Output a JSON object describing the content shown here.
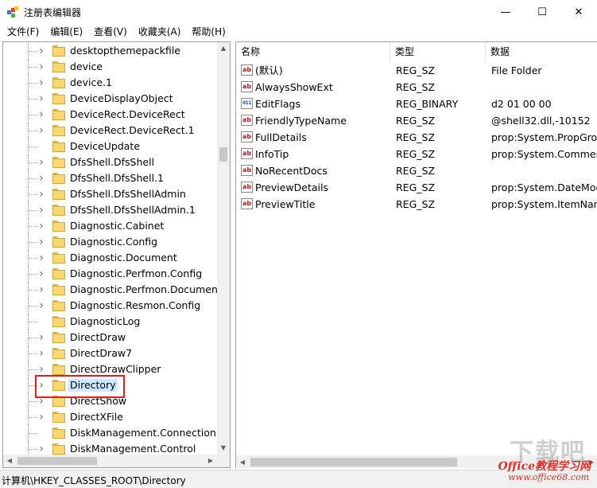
{
  "window": {
    "title": "注册表编辑器",
    "min_glyph": "—",
    "max_glyph": "☐",
    "close_glyph": "✕"
  },
  "menu": [
    "文件(F)",
    "编辑(E)",
    "查看(V)",
    "收藏夹(A)",
    "帮助(H)"
  ],
  "tree": {
    "items": [
      {
        "label": "desktopthemepackfile",
        "expandable": true
      },
      {
        "label": "device",
        "expandable": true
      },
      {
        "label": "device.1",
        "expandable": true
      },
      {
        "label": "DeviceDisplayObject",
        "expandable": true
      },
      {
        "label": "DeviceRect.DeviceRect",
        "expandable": true
      },
      {
        "label": "DeviceRect.DeviceRect.1",
        "expandable": true
      },
      {
        "label": "DeviceUpdate",
        "expandable": false
      },
      {
        "label": "DfsShell.DfsShell",
        "expandable": true
      },
      {
        "label": "DfsShell.DfsShell.1",
        "expandable": true
      },
      {
        "label": "DfsShell.DfsShellAdmin",
        "expandable": true
      },
      {
        "label": "DfsShell.DfsShellAdmin.1",
        "expandable": true
      },
      {
        "label": "Diagnostic.Cabinet",
        "expandable": true
      },
      {
        "label": "Diagnostic.Config",
        "expandable": true
      },
      {
        "label": "Diagnostic.Document",
        "expandable": true
      },
      {
        "label": "Diagnostic.Perfmon.Config",
        "expandable": true
      },
      {
        "label": "Diagnostic.Perfmon.Document",
        "expandable": true
      },
      {
        "label": "Diagnostic.Resmon.Config",
        "expandable": true
      },
      {
        "label": "DiagnosticLog",
        "expandable": false
      },
      {
        "label": "DirectDraw",
        "expandable": true
      },
      {
        "label": "DirectDraw7",
        "expandable": true
      },
      {
        "label": "DirectDrawClipper",
        "expandable": true
      },
      {
        "label": "Directory",
        "expandable": true,
        "selected": true
      },
      {
        "label": "DirectShow",
        "expandable": true
      },
      {
        "label": "DirectXFile",
        "expandable": true
      },
      {
        "label": "DiskManagement.Connection",
        "expandable": false
      },
      {
        "label": "DiskManagement.Control",
        "expandable": true
      }
    ]
  },
  "list": {
    "columns": [
      "名称",
      "类型",
      "数据"
    ],
    "rows": [
      {
        "name": "(默认)",
        "type": "REG_SZ",
        "data": "File Folder",
        "icon": "string-value-icon"
      },
      {
        "name": "AlwaysShowExt",
        "type": "REG_SZ",
        "data": "",
        "icon": "string-value-icon"
      },
      {
        "name": "EditFlags",
        "type": "REG_BINARY",
        "data": "d2 01 00 00",
        "icon": "binary-value-icon"
      },
      {
        "name": "FriendlyTypeName",
        "type": "REG_SZ",
        "data": "@shell32.dll,-10152",
        "icon": "string-value-icon"
      },
      {
        "name": "FullDetails",
        "type": "REG_SZ",
        "data": "prop:System.PropGrou",
        "icon": "string-value-icon"
      },
      {
        "name": "InfoTip",
        "type": "REG_SZ",
        "data": "prop:System.Comment",
        "icon": "string-value-icon"
      },
      {
        "name": "NoRecentDocs",
        "type": "REG_SZ",
        "data": "",
        "icon": "string-value-icon"
      },
      {
        "name": "PreviewDetails",
        "type": "REG_SZ",
        "data": "prop:System.DateMod",
        "icon": "string-value-icon"
      },
      {
        "name": "PreviewTitle",
        "type": "REG_SZ",
        "data": "prop:System.ItemNam",
        "icon": "string-value-icon"
      }
    ]
  },
  "status": {
    "path": "计算机\\HKEY_CLASSES_ROOT\\Directory"
  },
  "watermark": {
    "big": "下载吧",
    "brand": "Office教程学习网",
    "url": "www.office68.com"
  },
  "colors": {
    "selection": "#cce8ff",
    "highlight_border": "#e02020",
    "folder": "#f8d775"
  }
}
